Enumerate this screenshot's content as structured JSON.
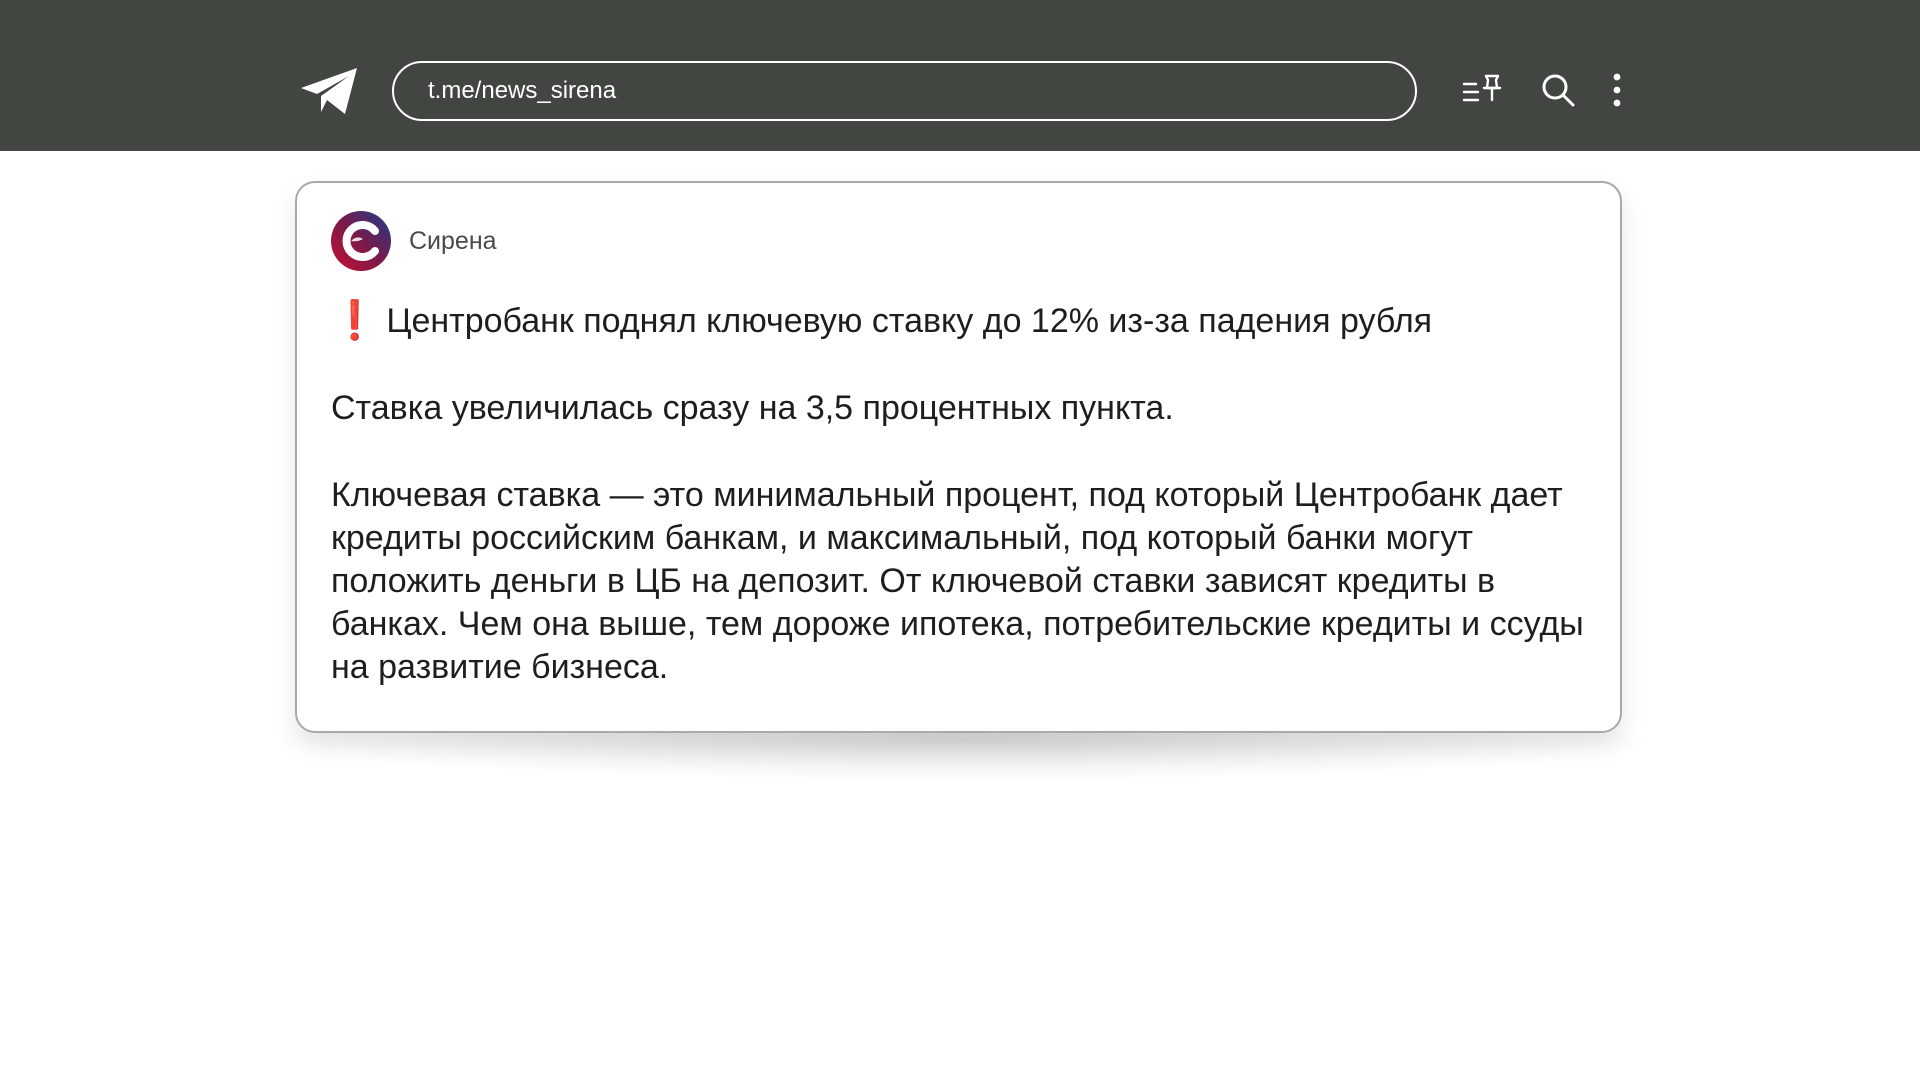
{
  "header": {
    "url": "t.me/news_sirena",
    "icons": [
      "telegram-logo-icon",
      "pinned-list-icon",
      "search-icon",
      "more-vertical-icon"
    ]
  },
  "post": {
    "channel_name": "Сирена",
    "headline_emoji": "❗",
    "headline": "Центробанк поднял ключевую ставку до 12% из-за падения рубля",
    "paragraphs": [
      "Ставка увеличилась сразу на 3,5 процентных пункта.",
      "Ключевая ставка — это минимальный процент, под который Центробанк дает кредиты российским банкам, и максимальный, под который банки могут положить деньги в ЦБ на депозит. От ключевой ставки зависят кредиты в банках. Чем она выше, тем дороже ипотека, потребительские кредиты и ссуды на развитие бизнеса."
    ]
  },
  "colors": {
    "topbar": "#424641",
    "accent_red": "#e0282e",
    "avatar_blue": "#1f3d8a",
    "text": "#1e1e1e"
  }
}
